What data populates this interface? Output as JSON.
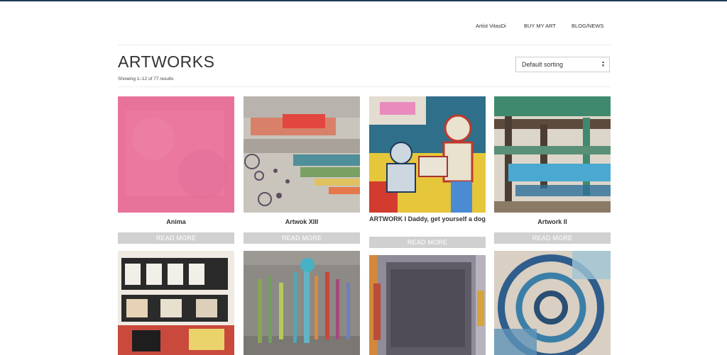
{
  "nav": {
    "items": [
      "Artist VitasDi",
      "BUY MY ART",
      "BLOG/NEWS"
    ]
  },
  "page": {
    "title": "ARTWORKS",
    "results": "Showing 1–12 of 77 results"
  },
  "sort": {
    "selected": "Default sorting"
  },
  "products": [
    {
      "title": "Anima",
      "button": "READ MORE"
    },
    {
      "title": "Artwok XIII",
      "button": "READ MORE"
    },
    {
      "title": "ARTWORK I Daddy, get yourself a dog",
      "button": "READ MORE"
    },
    {
      "title": "Artwork II",
      "button": "READ MORE"
    }
  ],
  "colors": {
    "button_bg": "#d0d0d0",
    "button_text": "#ffffff",
    "text": "#333333"
  }
}
